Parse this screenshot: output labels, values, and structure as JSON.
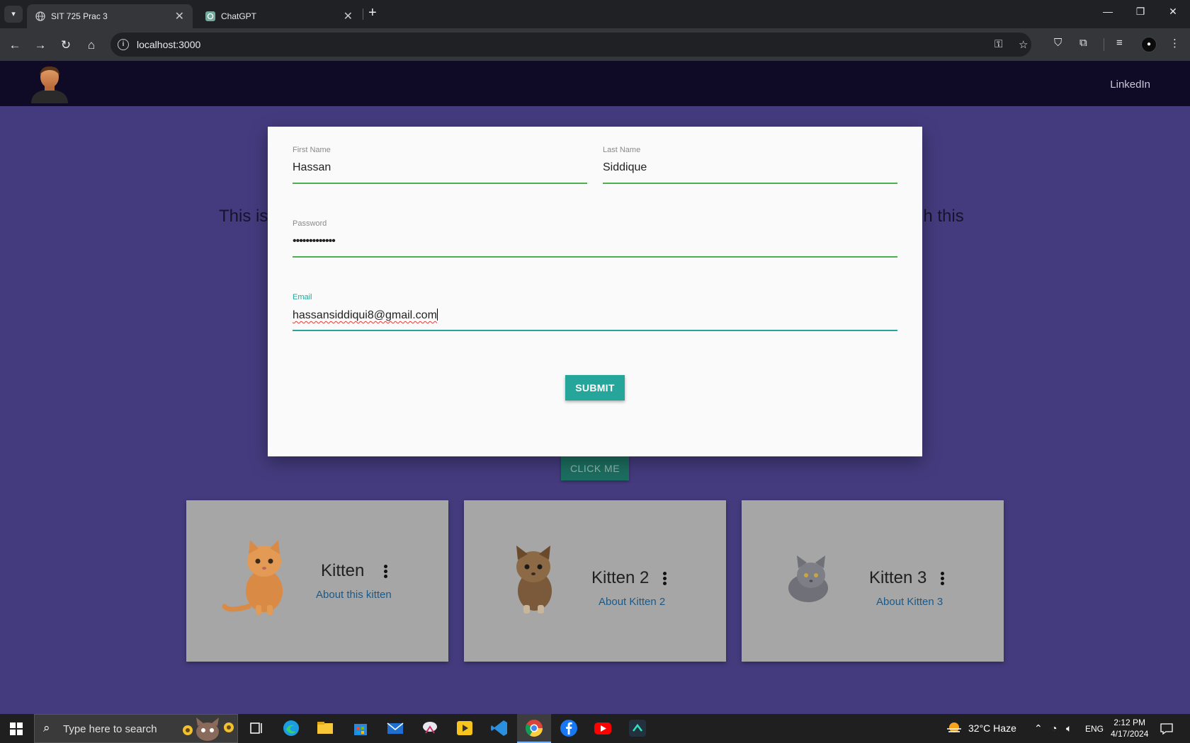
{
  "browser": {
    "tabs": [
      {
        "title": "SIT 725 Prac 3",
        "active": true
      },
      {
        "title": "ChatGPT",
        "active": false
      }
    ],
    "url": "localhost:3000"
  },
  "site": {
    "nav_link": "LinkedIn",
    "bg_text_left": "This is",
    "bg_text_right": "gh this",
    "click_me_label": "CLICK ME"
  },
  "form": {
    "first_name": {
      "label": "First Name",
      "value": "Hassan"
    },
    "last_name": {
      "label": "Last Name",
      "value": "Siddique"
    },
    "password": {
      "label": "Password",
      "value": "•••••••••••••"
    },
    "email": {
      "label": "Email",
      "value": "hassansiddiqui8@gmail.com",
      "focused": true
    },
    "submit_label": "SUBMIT"
  },
  "cards": [
    {
      "title": "Kitten",
      "link": "About this kitten"
    },
    {
      "title": "Kitten 2",
      "link": "About Kitten 2"
    },
    {
      "title": "Kitten 3",
      "link": "About Kitten 3"
    }
  ],
  "taskbar": {
    "search_placeholder": "Type here to search",
    "weather": "32°C  Haze",
    "language": "ENG",
    "time": "2:12 PM",
    "date": "4/17/2024"
  },
  "colors": {
    "page_bg": "#443b7e",
    "nav_bg": "#0f0b26",
    "accent_teal": "#26a69a",
    "field_underline": "#4caf50"
  }
}
